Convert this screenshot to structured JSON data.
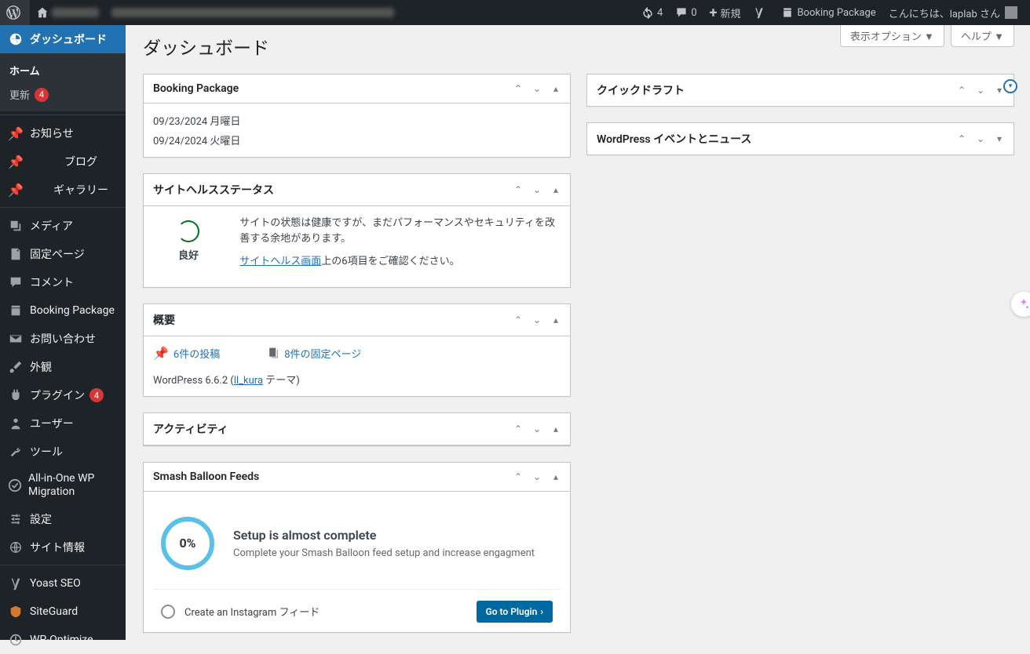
{
  "adminbar": {
    "updates": "4",
    "comments": "0",
    "new": "新規",
    "booking": "Booking Package",
    "greeting": "こんにちは、laplab さん"
  },
  "sidebar": {
    "dashboard": "ダッシュボード",
    "home": "ホーム",
    "updates": "更新",
    "updates_count": "4",
    "news": "お知らせ",
    "blog": "ブログ",
    "gallery": "ギャラリー",
    "media": "メディア",
    "pages": "固定ページ",
    "comments": "コメント",
    "booking": "Booking Package",
    "contact": "お問い合わせ",
    "appearance": "外観",
    "plugins": "プラグイン",
    "plugins_count": "4",
    "users": "ユーザー",
    "tools": "ツール",
    "aiowp": "All-in-One WP Migration",
    "settings": "設定",
    "siteinfo": "サイト情報",
    "yoast": "Yoast SEO",
    "siteguard": "SiteGuard",
    "wpoptimize": "WP-Optimize"
  },
  "page": {
    "title": "ダッシュボード",
    "screen_options": "表示オプション ▼",
    "help": "ヘルプ ▼"
  },
  "box_booking": {
    "title": "Booking Package",
    "line1": "09/23/2024 月曜日",
    "line2": "09/24/2024 火曜日"
  },
  "box_health": {
    "title": "サイトヘルスステータス",
    "status": "良好",
    "p1": "サイトの状態は健康ですが、まだパフォーマンスやセキュリティを改善する余地があります。",
    "link": "サイトヘルス画面",
    "p2a": "上の6項目をご確認ください。"
  },
  "box_overview": {
    "title": "概要",
    "posts": "6件の投稿",
    "pages": "8件の固定ページ",
    "version_a": "WordPress 6.6.2 (",
    "theme": "ll_kura",
    "version_b": " テーマ)"
  },
  "box_activity": {
    "title": "アクティビティ"
  },
  "box_sb": {
    "title": "Smash Balloon Feeds",
    "percent": "0%",
    "h": "Setup is almost complete",
    "p": "Complete your Smash Balloon feed setup and increase engagment",
    "task": "Create an Instagram フィード",
    "go": "Go to Plugin"
  },
  "box_quickdraft": {
    "title": "クイックドラフト"
  },
  "box_events": {
    "title": "WordPress イベントとニュース"
  }
}
